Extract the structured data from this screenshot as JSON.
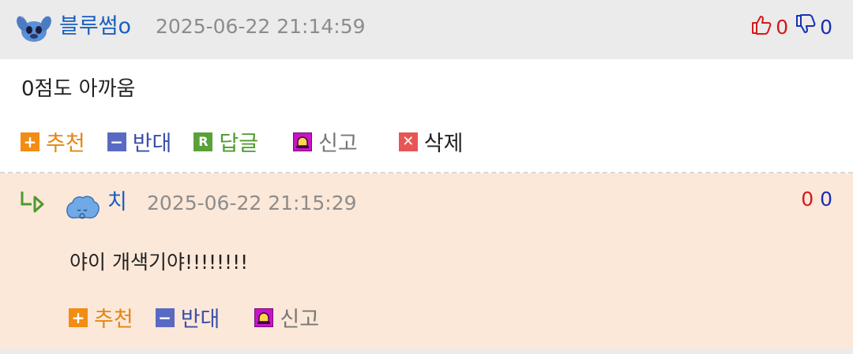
{
  "comment": {
    "nickname": "블루썸o",
    "timestamp": "2025-06-22 21:14:59",
    "likes": "0",
    "dislikes": "0",
    "text": "0점도 아까움",
    "actions": {
      "recommend": "추천",
      "oppose": "반대",
      "reply": "답글",
      "report": "신고",
      "delete": "삭제"
    }
  },
  "reply": {
    "nickname": "치",
    "timestamp": "2025-06-22 21:15:29",
    "likes": "0",
    "dislikes": "0",
    "text": "야이 개색기야!!!!!!!!",
    "actions": {
      "recommend": "추천",
      "oppose": "반대",
      "report": "신고"
    }
  },
  "icons": {
    "recommend": "plus-icon",
    "oppose": "minus-icon",
    "reply": "reply-r-icon",
    "report": "siren-icon",
    "delete": "close-icon",
    "thumbs_up": "thumbs-up-icon",
    "thumbs_down": "thumbs-down-icon",
    "reply_arrow": "reply-arrow-icon"
  },
  "colors": {
    "nickname": "#1a5fbf",
    "timestamp": "#8c8c8c",
    "recommend": "#f28c13",
    "oppose": "#5a6ac2",
    "reply": "#5aa13a",
    "report": "#c814c8",
    "delete": "#e85555",
    "reply_bg": "#fbe8d8",
    "header_bg": "#ebebeb"
  }
}
